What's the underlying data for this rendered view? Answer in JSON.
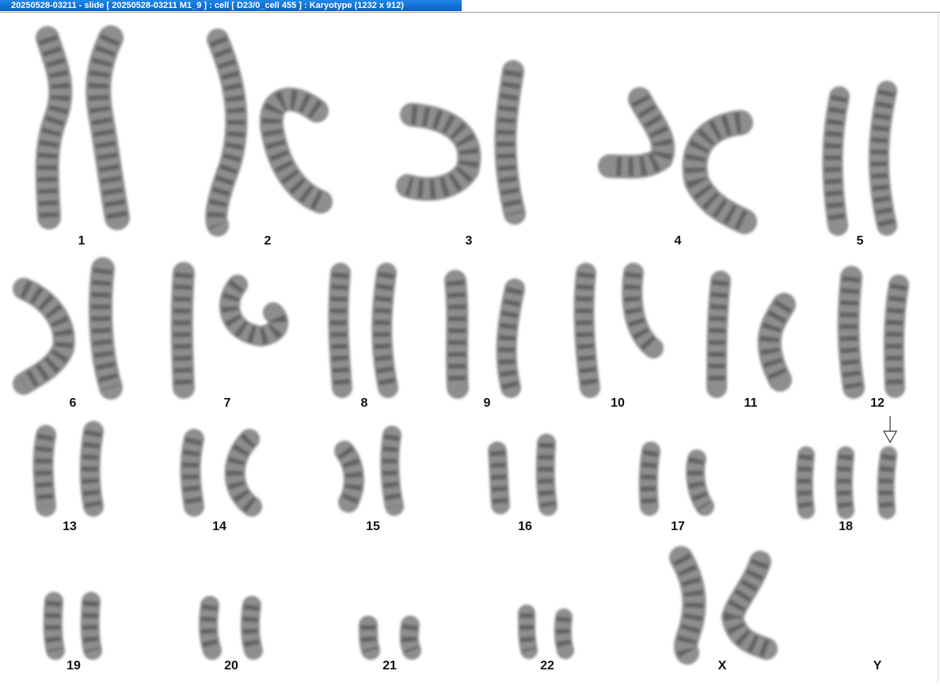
{
  "window": {
    "title": "20250528-03211 - slide [ 20250528-03211 M1_9 ] : cell [ D23/0_cell 455 ] : Karyotype  (1232 x 912)"
  },
  "colors": {
    "title_bg": "#0a5fc8",
    "chromosome": "#5a5a5a",
    "label": "#111111"
  },
  "karyotype": {
    "labels": {
      "c1": "1",
      "c2": "2",
      "c3": "3",
      "c4": "4",
      "c5": "5",
      "c6": "6",
      "c7": "7",
      "c8": "8",
      "c9": "9",
      "c10": "10",
      "c11": "11",
      "c12": "12",
      "c13": "13",
      "c14": "14",
      "c15": "15",
      "c16": "16",
      "c17": "17",
      "c18": "18",
      "c19": "19",
      "c20": "20",
      "c21": "21",
      "c22": "22",
      "cX": "X",
      "cY": "Y"
    },
    "annotation": {
      "icon": "down-arrow-icon",
      "target": "18"
    }
  }
}
